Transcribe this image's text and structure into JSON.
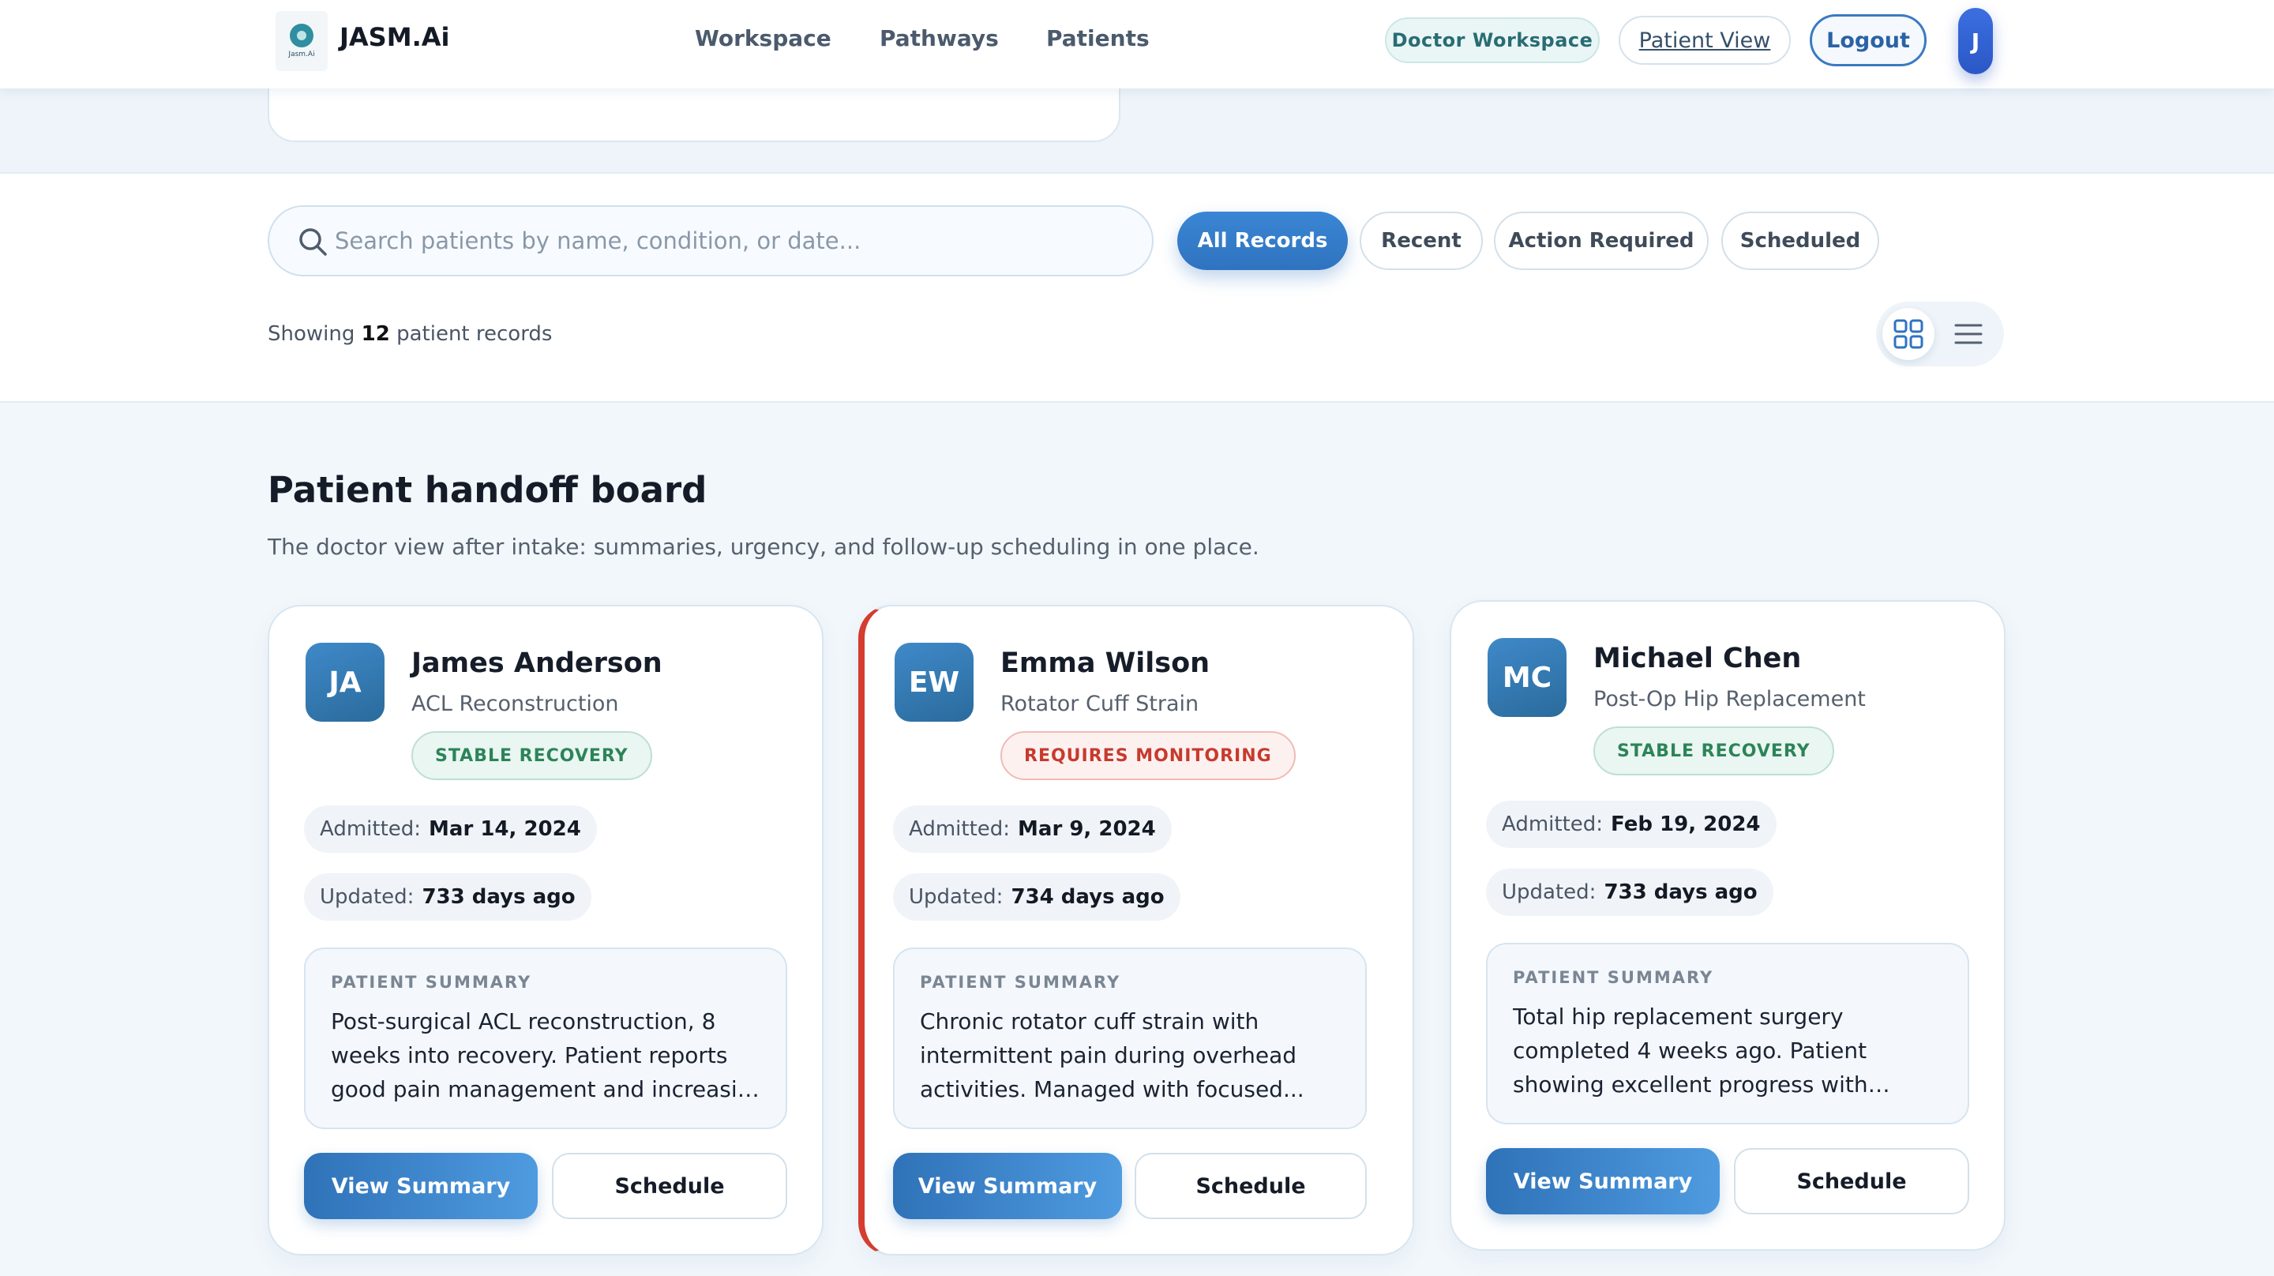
{
  "header": {
    "logo_text": "Jasm.Ai",
    "brand": "JASM.Ai",
    "nav": [
      "Workspace",
      "Pathways",
      "Patients"
    ],
    "doctor_workspace": "Doctor Workspace",
    "patient_view": "Patient View",
    "logout": "Logout",
    "avatar_initial": "J"
  },
  "search": {
    "placeholder": "Search patients by name, condition, or date..."
  },
  "filters": {
    "all": "All Records",
    "recent": "Recent",
    "action": "Action Required",
    "scheduled": "Scheduled",
    "active": "All Records"
  },
  "results": {
    "prefix": "Showing",
    "count": "12",
    "suffix": "patient records"
  },
  "board": {
    "title": "Patient handoff board",
    "subtitle": "The doctor view after intake: summaries, urgency, and follow-up scheduling in one place."
  },
  "labels": {
    "admitted": "Admitted:",
    "updated": "Updated:",
    "summary": "PATIENT SUMMARY",
    "view_summary": "View Summary",
    "schedule": "Schedule"
  },
  "patients": [
    {
      "initials": "JA",
      "name": "James Anderson",
      "condition": "ACL Reconstruction",
      "status": "STABLE RECOVERY",
      "admitted": "Mar 14, 2024",
      "updated": "733 days ago",
      "summary": "Post-surgical ACL reconstruction, 8 weeks into recovery. Patient reports good pain management and increasing range..."
    },
    {
      "initials": "EW",
      "name": "Emma Wilson",
      "condition": "Rotator Cuff Strain",
      "status": "REQUIRES MONITORING",
      "admitted": "Mar 9, 2024",
      "updated": "734 days ago",
      "summary": "Chronic rotator cuff strain with intermittent pain during overhead activities. Managed with focused..."
    },
    {
      "initials": "MC",
      "name": "Michael Chen",
      "condition": "Post-Op Hip Replacement",
      "status": "STABLE RECOVERY",
      "admitted": "Feb 19, 2024",
      "updated": "733 days ago",
      "summary": "Total hip replacement surgery completed 4 weeks ago. Patient showing excellent progress with mobility and strength. Pai..."
    }
  ],
  "colors": {
    "primary": "#2f73c0",
    "alert": "#d43d2f",
    "stable": "#2c8459"
  },
  "icons": [
    "search-icon",
    "grid-view-icon",
    "list-view-icon"
  ]
}
